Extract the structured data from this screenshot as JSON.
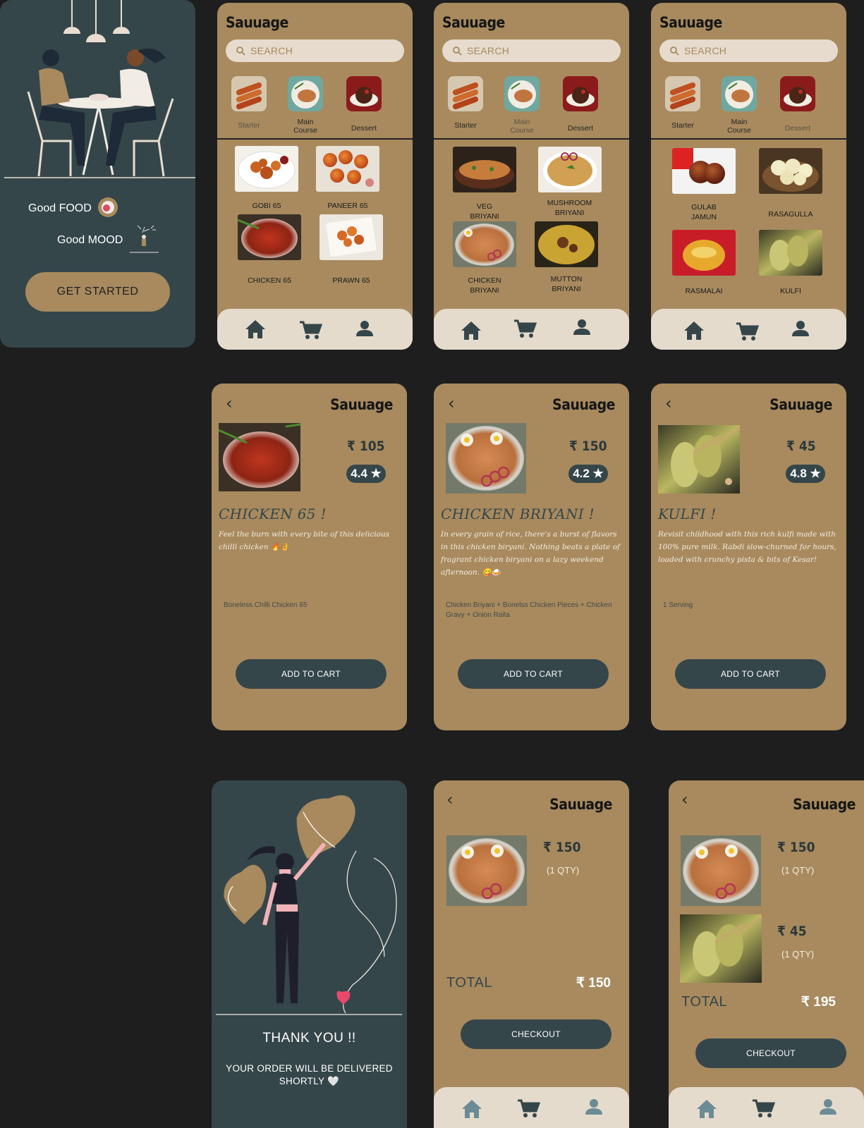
{
  "brand": "Sauuage",
  "onboarding": {
    "line1": "Good FOOD",
    "line2": "Good MOOD",
    "cta": "GET STARTED"
  },
  "search_placeholder": "SEARCH",
  "categories": {
    "starter": "Starter",
    "main": "Main\nCourse",
    "dessert": "Dessert"
  },
  "starter_items": [
    "GOBI 65",
    "PANEER 65",
    "CHICKEN 65",
    "PRAWN 65"
  ],
  "main_items": [
    "VEG\nBRIYANI",
    "MUSHROOM\nBRIYANI",
    "CHICKEN\nBRIYANI",
    "MUTTON\nBRIYANI"
  ],
  "dessert_items": [
    "GULAB\nJAMUN",
    "RASAGULLA",
    "RASMALAI",
    "KULFI"
  ],
  "details": [
    {
      "price": "₹ 105",
      "rating": "4.4 ★",
      "title": "CHICKEN 65 !",
      "desc": "Feel the burn with every bite of this delicious chilli chicken 🔥👌",
      "serving": "Boneless Chilli Chicken 65",
      "button": "ADD TO CART"
    },
    {
      "price": "₹ 150",
      "rating": "4.2 ★",
      "title": "CHICKEN BRIYANI !",
      "desc": "In every grain of rice, there's a burst of flavors in this chicken biryani. Nothing beats a plate of fragrant chicken biryani on a lazy weekend afternoon. 😋🍛",
      "serving": "Chicken Briyani + Bonelss Chicken Pieces + Chicken Gravy + Onion Raita",
      "button": "ADD TO CART"
    },
    {
      "price": "₹ 45",
      "rating": "4.8 ★",
      "title": "KULFI !",
      "desc": "Revisit childhood with this rich kulfi made with 100% pure milk. Rabdi slow-churned for hours, loaded with crunchy pista & bits of Kesar!",
      "serving": "1 Serving",
      "button": "ADD TO CART"
    }
  ],
  "thanks": {
    "title": "THANK  YOU !!",
    "line": "YOUR  ORDER WILL BE DELIVERED SHORTLY 🤍"
  },
  "cart1": {
    "item_price": "₹ 150",
    "item_qty": "(1 QTY)",
    "total_label": "TOTAL",
    "total": "₹ 150",
    "button": "CHECKOUT"
  },
  "cart2": {
    "item1_price": "₹ 150",
    "item1_qty": "(1 QTY)",
    "item2_price": "₹ 45",
    "item2_qty": "(1 QTY)",
    "total_label": "TOTAL",
    "total": "₹ 195",
    "button": "CHECKOUT"
  },
  "colors": {
    "tan": "#a88a5e",
    "dark": "#35464a",
    "cream": "#e5dbcd",
    "background": "#1e1e1e"
  },
  "icons": [
    "search-icon",
    "home-icon",
    "cart-icon",
    "user-icon",
    "back-icon"
  ]
}
